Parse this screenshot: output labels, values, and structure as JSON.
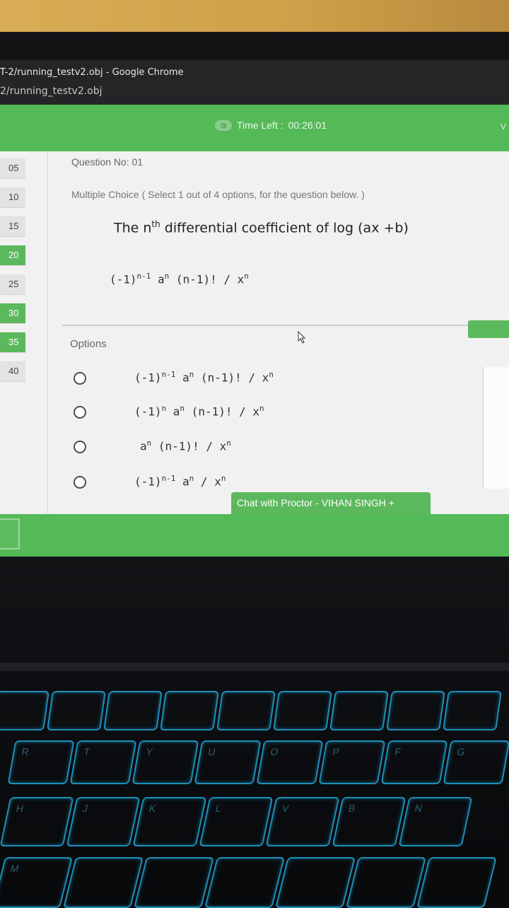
{
  "browser": {
    "window_title": "T-2/running_testv2.obj - Google Chrome",
    "url": "2/running_testv2.obj"
  },
  "exam": {
    "time_left_label": "Time Left :",
    "time_left_value": "00:26:01",
    "header_right": "V",
    "question_nav": [
      {
        "label": "05",
        "answered": false
      },
      {
        "label": "10",
        "answered": false
      },
      {
        "label": "15",
        "answered": false
      },
      {
        "label": "20",
        "answered": true
      },
      {
        "label": "25",
        "answered": false
      },
      {
        "label": "30",
        "answered": true
      },
      {
        "label": "35",
        "answered": true
      },
      {
        "label": "40",
        "answered": false
      }
    ],
    "question": {
      "number_label": "Question No: 01",
      "type_label": "Multiple Choice ( Select 1 out of 4 options, for the question below. )",
      "text_before": "The n",
      "text_sup": "th",
      "text_after": " differential coefficient of  log (ax +b)",
      "formula": {
        "p1": "(-1)",
        "s1": "n-1",
        "p2": " a",
        "s2": "n",
        "p3": " (n-1)!  / x",
        "s3": "n"
      }
    },
    "options_label": "Options",
    "options": [
      {
        "p1": "(-1)",
        "s1": "n-1",
        "p2": " a",
        "s2": "n",
        "p3": " (n-1)!  / x",
        "s3": "n"
      },
      {
        "p1": "(-1)",
        "s1": "n",
        "p2": " a",
        "s2": "n",
        "p3": " (n-1)!  / x",
        "s3": "n"
      },
      {
        "p1": " a",
        "s1": "n",
        "p2": " (n-1)!  / x",
        "s2": "n",
        "p3": "",
        "s3": ""
      },
      {
        "p1": "(-1)",
        "s1": "n-1",
        "p2": " a",
        "s2": "n",
        "p3": "  / x",
        "s3": "n"
      }
    ],
    "chat_button": "Chat with Proctor - VIHAN SINGH   +"
  },
  "keyboard": {
    "keys": [
      "R",
      "T",
      "Y",
      "U",
      "O",
      "P",
      "F",
      "G",
      "H",
      "J",
      "K",
      "L",
      "V",
      "B",
      "N",
      "M"
    ]
  },
  "colors": {
    "accent_green": "#5cb85c",
    "header_green": "#54b957",
    "page_bg": "#f1f1f1"
  }
}
